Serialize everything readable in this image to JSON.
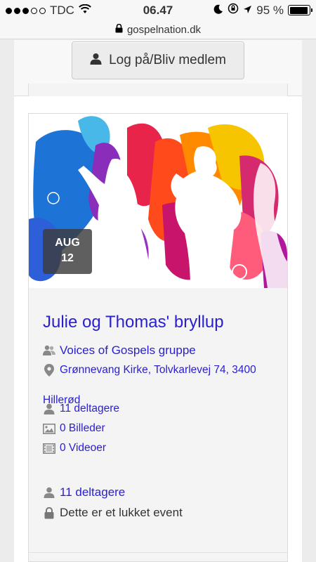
{
  "status_bar": {
    "carrier": "TDC",
    "time": "06.47",
    "battery_text": "95 %",
    "battery_level": 0.95,
    "signal_bars": 3,
    "signal_total": 5
  },
  "url_bar": {
    "domain": "gospelnation.dk"
  },
  "header": {
    "login_label": "Log på/Bliv medlem"
  },
  "event": {
    "date_month": "AUG",
    "date_day": "12",
    "title": "Julie og Thomas' bryllup",
    "group": "Voices of Gospels gruppe",
    "address_line1": "Grønnevang Kirke, Tolvkarlevej 74, 3400",
    "address_line2": "Hillerød",
    "participants": "11 deltagere",
    "photos": "0 Billeder",
    "videos": "0 Videoer",
    "footer_participants": "11 deltagere",
    "closed_notice": "Dette er et lukket event"
  },
  "colors": {
    "link": "#2a20d0",
    "page_bg": "#ececec"
  },
  "icons": [
    "wifi-icon",
    "moon-icon",
    "orientation-lock-icon",
    "location-arrow-icon",
    "battery-icon",
    "lock-icon",
    "user-icon",
    "users-icon",
    "map-marker-icon",
    "picture-icon",
    "film-icon"
  ]
}
